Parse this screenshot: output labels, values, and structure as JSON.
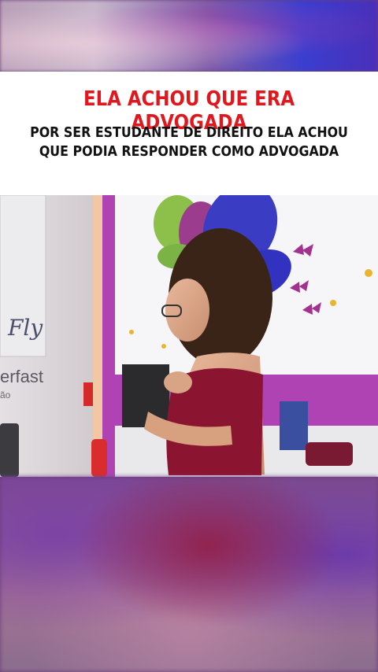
{
  "caption": {
    "headline": "ELA ACHOU QUE ERA ADVOGADA",
    "subline_1": "POR SER ESTUDANTE DE DIREITO ELA ACHOU",
    "subline_2": "QUE PODIA RESPONDER COMO ADVOGADA"
  },
  "scene": {
    "sign_fly": "Fly",
    "sign_brand": "erfast",
    "sign_brand_sub": "ão"
  },
  "colors": {
    "headline": "#e0181e",
    "subline": "#111111",
    "caption_bg": "#ffffff"
  }
}
